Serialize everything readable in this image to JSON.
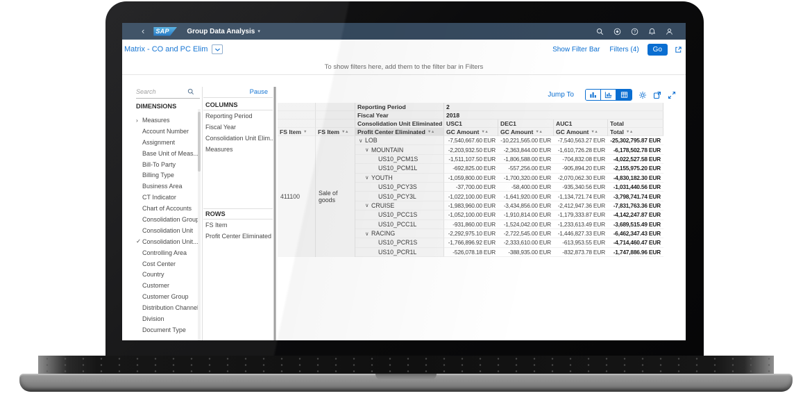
{
  "colors": {
    "accent": "#0a6ed1",
    "shell_bar": "#364a5f"
  },
  "shell": {
    "logo": "SAP",
    "app_title": "Group Data Analysis",
    "icons": [
      "search",
      "copilot",
      "help",
      "notifications",
      "profile"
    ]
  },
  "page_header": {
    "title": "Matrix - CO and PC Elim",
    "show_filter_bar": "Show Filter Bar",
    "filters": "Filters (4)",
    "go": "Go"
  },
  "filter_hint": "To show filters here, add them to the filter bar in Filters",
  "dimensions": {
    "search_placeholder": "Search",
    "title": "DIMENSIONS",
    "items": [
      {
        "label": "Measures",
        "chevron": true
      },
      {
        "label": "Account Number"
      },
      {
        "label": "Assignment"
      },
      {
        "label": "Base Unit of Meas..."
      },
      {
        "label": "Bill-To Party"
      },
      {
        "label": "Billing Type"
      },
      {
        "label": "Business Area"
      },
      {
        "label": "CT Indicator"
      },
      {
        "label": "Chart of Accounts"
      },
      {
        "label": "Consolidation Group"
      },
      {
        "label": "Consolidation Unit"
      },
      {
        "label": "Consolidation Unit...",
        "checked": true
      },
      {
        "label": "Controlling Area"
      },
      {
        "label": "Cost Center"
      },
      {
        "label": "Country"
      },
      {
        "label": "Customer"
      },
      {
        "label": "Customer Group"
      },
      {
        "label": "Distribution Channel"
      },
      {
        "label": "Division"
      },
      {
        "label": "Document Type"
      }
    ]
  },
  "builder": {
    "pause": "Pause",
    "columns_title": "COLUMNS",
    "columns": [
      "Reporting Period",
      "Fiscal Year",
      "Consolidation Unit Elim...",
      "Measures"
    ],
    "rows_title": "ROWS",
    "rows": [
      "FS Item",
      "Profit Center Eliminated"
    ]
  },
  "toolbar": {
    "jump_to": "Jump To"
  },
  "table": {
    "reporting_period_label": "Reporting Period",
    "reporting_period_value": "2",
    "fiscal_year_label": "Fiscal Year",
    "fiscal_year_value": "2018",
    "cu_elim_label": "Consolidation Unit Eliminated",
    "unit_headers": [
      "USC1",
      "DEC1",
      "AUC1",
      "Total"
    ],
    "fs_item_header": "FS Item",
    "pc_elim_header": "Profit Center Eliminated",
    "amount_header": "GC Amount",
    "total_header": "Total",
    "fs_item_key": "411100",
    "fs_item_text": "Sale of goods",
    "rows": [
      {
        "label": "LOB",
        "level": 1,
        "expanded": true,
        "values": [
          "-7,540,667.60 EUR",
          "-10,221,565.00 EUR",
          "-7,540,563.27 EUR",
          "-25,302,795.87 EUR"
        ]
      },
      {
        "label": "MOUNTAIN",
        "level": 2,
        "expanded": true,
        "values": [
          "-2,203,932.50 EUR",
          "-2,363,844.00 EUR",
          "-1,610,726.28 EUR",
          "-6,178,502.78 EUR"
        ]
      },
      {
        "label": "US10_PCM1S",
        "level": 3,
        "expanded": false,
        "values": [
          "-1,511,107.50 EUR",
          "-1,806,588.00 EUR",
          "-704,832.08 EUR",
          "-4,022,527.58 EUR"
        ]
      },
      {
        "label": "US10_PCM1L",
        "level": 3,
        "expanded": false,
        "values": [
          "-692,825.00 EUR",
          "-557,256.00 EUR",
          "-905,894.20 EUR",
          "-2,155,975.20 EUR"
        ]
      },
      {
        "label": "YOUTH",
        "level": 2,
        "expanded": true,
        "values": [
          "-1,059,800.00 EUR",
          "-1,700,320.00 EUR",
          "-2,070,062.30 EUR",
          "-4,830,182.30 EUR"
        ]
      },
      {
        "label": "US10_PCY3S",
        "level": 3,
        "expanded": false,
        "values": [
          "-37,700.00 EUR",
          "-58,400.00 EUR",
          "-935,340.56 EUR",
          "-1,031,440.56 EUR"
        ]
      },
      {
        "label": "US10_PCY3L",
        "level": 3,
        "expanded": false,
        "values": [
          "-1,022,100.00 EUR",
          "-1,641,920.00 EUR",
          "-1,134,721.74 EUR",
          "-3,798,741.74 EUR"
        ]
      },
      {
        "label": "CRUISE",
        "level": 2,
        "expanded": true,
        "values": [
          "-1,983,960.00 EUR",
          "-3,434,856.00 EUR",
          "-2,412,947.36 EUR",
          "-7,831,763.36 EUR"
        ]
      },
      {
        "label": "US10_PCC1S",
        "level": 3,
        "expanded": false,
        "values": [
          "-1,052,100.00 EUR",
          "-1,910,814.00 EUR",
          "-1,179,333.87 EUR",
          "-4,142,247.87 EUR"
        ]
      },
      {
        "label": "US10_PCC1L",
        "level": 3,
        "expanded": false,
        "values": [
          "-931,860.00 EUR",
          "-1,524,042.00 EUR",
          "-1,233,613.49 EUR",
          "-3,689,515.49 EUR"
        ]
      },
      {
        "label": "RACING",
        "level": 2,
        "expanded": true,
        "values": [
          "-2,292,975.10 EUR",
          "-2,722,545.00 EUR",
          "-1,446,827.33 EUR",
          "-6,462,347.43 EUR"
        ]
      },
      {
        "label": "US10_PCR1S",
        "level": 3,
        "expanded": false,
        "values": [
          "-1,766,896.92 EUR",
          "-2,333,610.00 EUR",
          "-613,953.55 EUR",
          "-4,714,460.47 EUR"
        ]
      },
      {
        "label": "US10_PCR1L",
        "level": 3,
        "expanded": false,
        "values": [
          "-526,078.18 EUR",
          "-388,935.00 EUR",
          "-832,873.78 EUR",
          "-1,747,886.96 EUR"
        ]
      }
    ]
  }
}
